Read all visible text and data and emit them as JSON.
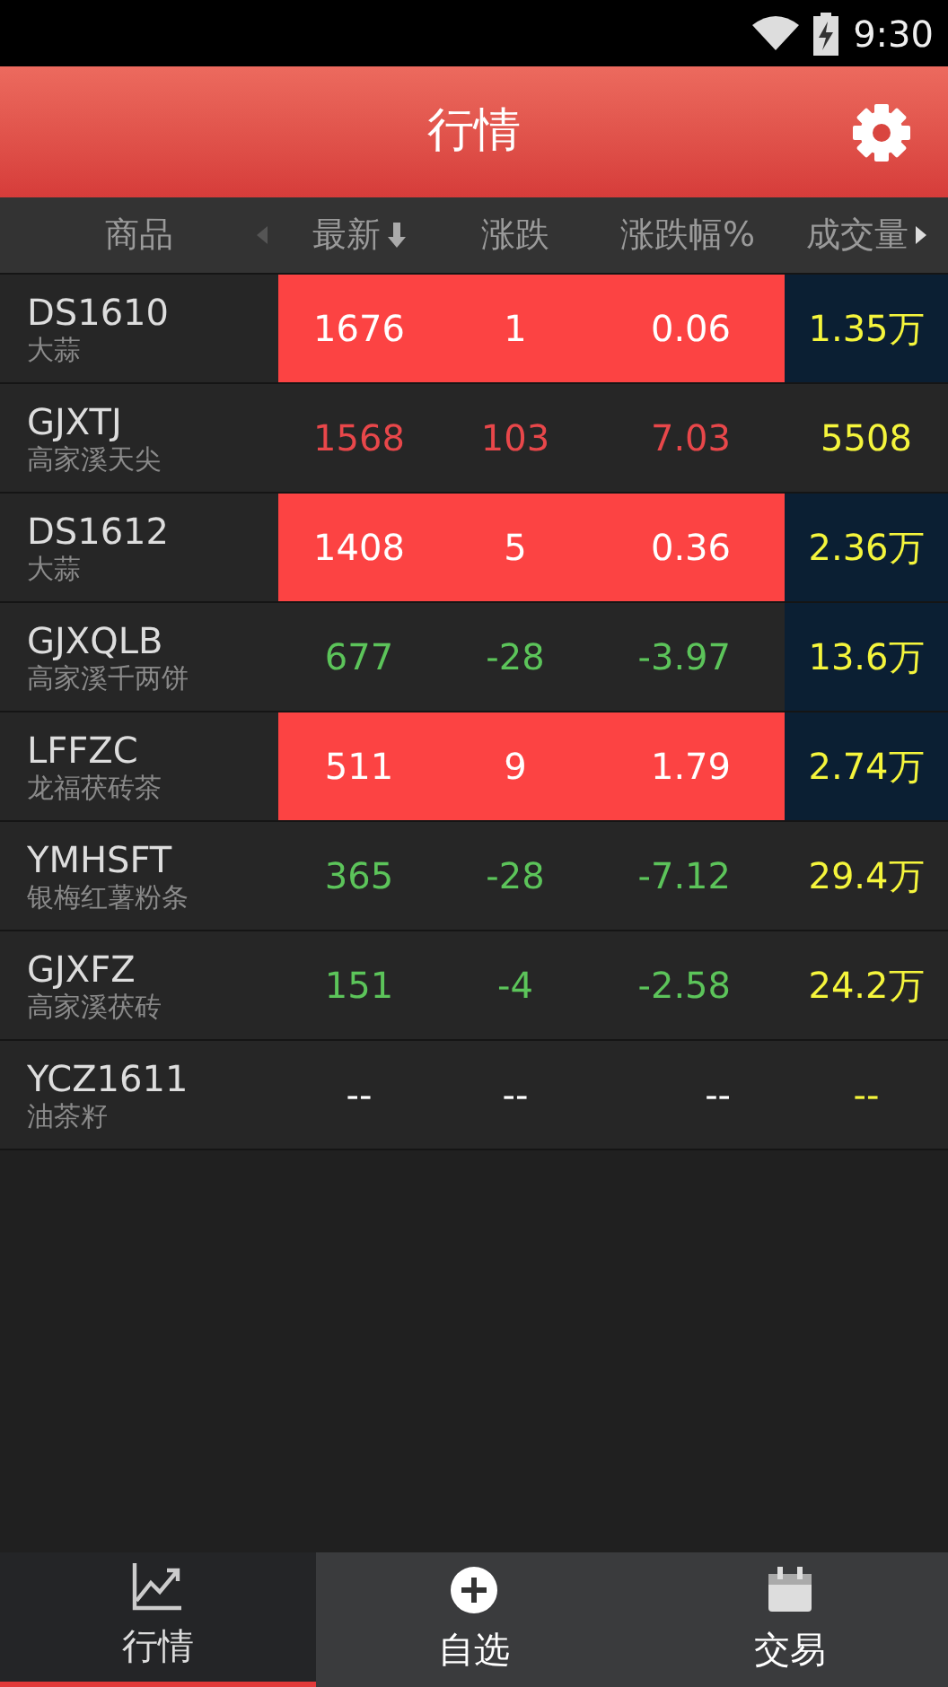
{
  "status_bar": {
    "time": "9:30"
  },
  "app_bar": {
    "title": "行情"
  },
  "columns": [
    {
      "label": "商品",
      "kind": "name"
    },
    {
      "label": "最新",
      "kind": "sorted"
    },
    {
      "label": "涨跌",
      "kind": "plain"
    },
    {
      "label": "涨跌幅%",
      "kind": "plain"
    },
    {
      "label": "成交量",
      "kind": "more"
    }
  ],
  "rows": [
    {
      "code": "DS1610",
      "name": "大蒜",
      "latest": "1676",
      "change": "1",
      "percent": "0.06",
      "volume": "1.35万",
      "rising": true,
      "falling": false,
      "flash": true,
      "volume_flash": true
    },
    {
      "code": "GJXTJ",
      "name": "高家溪天尖",
      "latest": "1568",
      "change": "103",
      "percent": "7.03",
      "volume": "5508",
      "rising": true,
      "falling": false,
      "flash": false,
      "volume_flash": false
    },
    {
      "code": "DS1612",
      "name": "大蒜",
      "latest": "1408",
      "change": "5",
      "percent": "0.36",
      "volume": "2.36万",
      "rising": true,
      "falling": false,
      "flash": true,
      "volume_flash": true
    },
    {
      "code": "GJXQLB",
      "name": "高家溪千两饼",
      "latest": "677",
      "change": "-28",
      "percent": "-3.97",
      "volume": "13.6万",
      "rising": false,
      "falling": true,
      "flash": false,
      "volume_flash": true
    },
    {
      "code": "LFFZC",
      "name": "龙福茯砖茶",
      "latest": "511",
      "change": "9",
      "percent": "1.79",
      "volume": "2.74万",
      "rising": true,
      "falling": false,
      "flash": true,
      "volume_flash": true
    },
    {
      "code": "YMHSFT",
      "name": "银梅红薯粉条",
      "latest": "365",
      "change": "-28",
      "percent": "-7.12",
      "volume": "29.4万",
      "rising": false,
      "falling": true,
      "flash": false,
      "volume_flash": false
    },
    {
      "code": "GJXFZ",
      "name": "高家溪茯砖",
      "latest": "151",
      "change": "-4",
      "percent": "-2.58",
      "volume": "24.2万",
      "rising": false,
      "falling": true,
      "flash": false,
      "volume_flash": false
    },
    {
      "code": "YCZ1611",
      "name": "油茶籽",
      "latest": "--",
      "change": "--",
      "percent": "--",
      "volume": "--",
      "rising": false,
      "falling": false,
      "flash": false,
      "volume_flash": false
    }
  ],
  "tabs": [
    {
      "label": "行情",
      "kind": "chart",
      "selected": true
    },
    {
      "label": "自选",
      "kind": "add",
      "selected": false
    },
    {
      "label": "交易",
      "kind": "calendar",
      "selected": false
    }
  ]
}
